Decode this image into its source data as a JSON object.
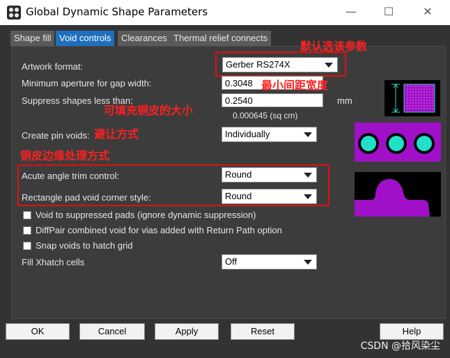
{
  "window": {
    "title": "Global Dynamic Shape Parameters",
    "minimize": "—",
    "maximize": "☐",
    "close": "✕"
  },
  "tabs": [
    {
      "label": "Shape fill",
      "active": false
    },
    {
      "label": "Void controls",
      "active": true
    },
    {
      "label": "Clearances",
      "active": false
    },
    {
      "label": "Thermal relief connects",
      "active": false
    }
  ],
  "form": {
    "artwork_format_label": "Artwork format:",
    "artwork_format_value": "Gerber RS274X",
    "min_aperture_label": "Minimum aperture for gap width:",
    "min_aperture_value": "0.3048",
    "suppress_label": "Suppress shapes less than:",
    "suppress_value": "0.2540",
    "suppress_unit": "mm",
    "suppress_area": "0.000645 (sq cm)",
    "pin_voids_label": "Create pin voids:",
    "pin_voids_value": "Individually",
    "acute_label": "Acute angle trim control:",
    "acute_value": "Round",
    "rect_pad_label": "Rectangle pad void corner style:",
    "rect_pad_value": "Round",
    "chk_suppressed": "Void to suppressed pads (ignore dynamic suppression)",
    "chk_diffpair": "DiffPair combined void for vias added with Return Path option",
    "chk_snap": "Snap voids to hatch grid",
    "fill_xhatch_label": "Fill Xhatch cells",
    "fill_xhatch_value": "Off"
  },
  "annotations": {
    "default_param": "默认选该参数",
    "min_gap": "最小间距宽度",
    "fill_copper": "可填充铜皮的大小",
    "avoid_mode": "避让方式",
    "edge_mode": "铜皮边缘处理方式"
  },
  "buttons": {
    "ok": "OK",
    "cancel": "Cancel",
    "apply": "Apply",
    "reset": "Reset",
    "help": "Help"
  },
  "watermark": "CSDN @拾风染尘",
  "colors": {
    "accent_tab": "#1f6fbf",
    "preview_magenta": "#a010c8",
    "preview_cyan": "#20e0c8",
    "annotation_red": "#ff2020"
  }
}
